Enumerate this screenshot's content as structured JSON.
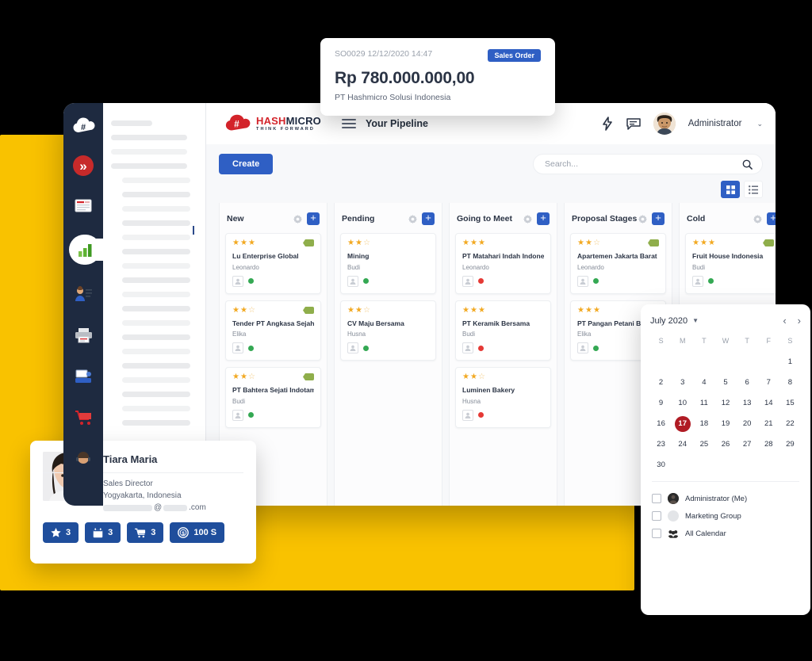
{
  "sales_order_popup": {
    "meta": "SO0029 12/12/2020 14:47",
    "badge": "Sales Order",
    "amount": "Rp 780.000.000,00",
    "company": "PT Hashmicro Solusi Indonesia"
  },
  "app": {
    "brand": {
      "hash": "HASH",
      "micro": "MICRO",
      "tagline": "THINK FORWARD"
    },
    "page_title": "Your Pipeline",
    "user": "Administrator",
    "caret": "⌄"
  },
  "sidebar": {
    "items": [
      {
        "name": "collapse-expand",
        "icon": "»"
      },
      {
        "name": "news",
        "icon": "news-icon"
      },
      {
        "name": "analytics",
        "icon": "bar-chart-icon",
        "active": true
      },
      {
        "name": "crm",
        "icon": "person-list-icon"
      },
      {
        "name": "print",
        "icon": "printer-icon"
      },
      {
        "name": "pos",
        "icon": "pos-terminal-icon"
      },
      {
        "name": "purchase",
        "icon": "shopping-cart-icon"
      },
      {
        "name": "support",
        "icon": "support-agent-icon"
      }
    ]
  },
  "toolbar": {
    "create_label": "Create",
    "search_placeholder": "Search...",
    "search_value": "",
    "view_grid": "grid-view",
    "view_list": "list-view"
  },
  "kanban": {
    "columns": [
      {
        "title": "New",
        "cards": [
          {
            "stars": 3,
            "title": "Lu Enterprise Global",
            "owner": "Leonardo",
            "status": "green",
            "tag": true
          },
          {
            "stars": 2,
            "title": "Tender PT Angkasa Sejahtera",
            "owner": "Elika",
            "status": "green",
            "tag": true
          },
          {
            "stars": 2,
            "title": "PT Bahtera Sejati Indotama",
            "owner": "Budi",
            "status": "green",
            "tag": true
          }
        ]
      },
      {
        "title": "Pending",
        "cards": [
          {
            "stars": 2,
            "title": "Mining",
            "owner": "Budi",
            "status": "green",
            "tag": false
          },
          {
            "stars": 2,
            "title": "CV Maju Bersama",
            "owner": "Husna",
            "status": "green",
            "tag": false
          }
        ]
      },
      {
        "title": "Going to Meet",
        "cards": [
          {
            "stars": 3,
            "title": "PT Matahari Indah Indonesia",
            "owner": "Leonardo",
            "status": "red",
            "tag": false
          },
          {
            "stars": 3,
            "title": "PT Keramik Bersama",
            "owner": "Budi",
            "status": "red",
            "tag": false
          },
          {
            "stars": 2,
            "title": "Luminen Bakery",
            "owner": "Husna",
            "status": "red",
            "tag": false
          }
        ]
      },
      {
        "title": "Proposal Stages",
        "cards": [
          {
            "stars": 2,
            "title": "Apartemen Jakarta Barat",
            "owner": "Leonardo",
            "status": "green",
            "tag": true
          },
          {
            "stars": 3,
            "title": "PT Pangan Petani Bersama",
            "owner": "Elika",
            "status": "green",
            "tag": true
          }
        ]
      },
      {
        "title": "Cold",
        "cards": [
          {
            "stars": 3,
            "title": "Fruit House Indonesia",
            "owner": "Budi",
            "status": "green",
            "tag": true
          }
        ]
      }
    ]
  },
  "calendar": {
    "month": "July 2020",
    "prev": "‹",
    "next": "›",
    "dow": [
      "S",
      "M",
      "T",
      "W",
      "T",
      "F",
      "S"
    ],
    "leading_blanks": 6,
    "days": [
      1,
      2,
      3,
      4,
      5,
      6,
      7,
      8,
      9,
      10,
      11,
      12,
      13,
      14,
      15,
      16,
      17,
      18,
      19,
      20,
      21,
      22,
      23,
      24,
      25,
      26,
      27,
      28,
      29,
      30
    ],
    "today": 17,
    "today_color": "#B01B24",
    "lists": [
      {
        "label": "Administrator (Me)",
        "avatar": "dark",
        "checked": false
      },
      {
        "label": "Marketing Group",
        "avatar": "grey",
        "checked": false
      },
      {
        "label": "All Calendar",
        "avatar": "group",
        "checked": false
      }
    ]
  },
  "profile": {
    "name": "Tiara Maria",
    "role": "Sales Director",
    "location": "Yogyakarta, Indonesia",
    "email_at": "@",
    "email_tld": ".com",
    "stats": [
      {
        "icon": "star-icon",
        "value": "3"
      },
      {
        "icon": "calendar-icon",
        "value": "3"
      },
      {
        "icon": "cart-icon",
        "value": "3"
      },
      {
        "icon": "coin-icon",
        "value": "100 S"
      }
    ]
  },
  "colors": {
    "accent_blue": "#2F5FC4",
    "brand_red": "#D3232A",
    "sidebar_dark": "#1E2A40",
    "backdrop_yellow": "#F9C200",
    "status_green": "#34A853",
    "status_red": "#E53935",
    "star_gold": "#F2A922"
  }
}
